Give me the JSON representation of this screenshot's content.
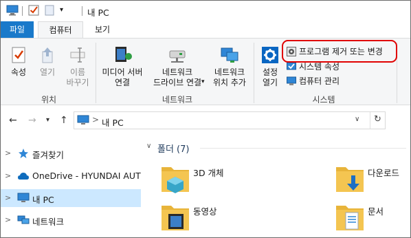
{
  "window": {
    "title": "내 PC"
  },
  "ribbon_tabs": [
    "파일",
    "컴퓨터",
    "보기"
  ],
  "ribbon": {
    "location_group": {
      "label": "위치",
      "properties": "속성",
      "open": "열기",
      "rename": "이름\n바꾸기"
    },
    "network_group": {
      "label": "네트워크",
      "media_server": "미디어 서버\n연결",
      "map_drive": "네트워크\n드라이브 연결",
      "add_location": "네트워크\n위치 추가"
    },
    "system_group": {
      "label": "시스템",
      "open_settings": "설정\n열기",
      "uninstall": "프로그램 제거 또는 변경",
      "system_properties": "시스템 속성",
      "computer_management": "컴퓨터 관리"
    }
  },
  "address_bar": {
    "path": "내 PC",
    "separator": ">"
  },
  "nav_pane": {
    "items": [
      {
        "label": "즐겨찾기",
        "icon": "star-icon",
        "selected": false
      },
      {
        "label": "OneDrive - HYUNDAI AUTOE",
        "icon": "cloud-icon",
        "selected": false
      },
      {
        "label": "내 PC",
        "icon": "computer-icon",
        "selected": true
      },
      {
        "label": "네트워크",
        "icon": "network-icon",
        "selected": false
      }
    ]
  },
  "content": {
    "section_title": "폴더 (7)",
    "folders": [
      {
        "name": "3D 개체",
        "icon": "3d-objects-folder-icon"
      },
      {
        "name": "다운로드",
        "icon": "downloads-folder-icon"
      },
      {
        "name": "동영상",
        "icon": "videos-folder-icon"
      },
      {
        "name": "문서",
        "icon": "documents-folder-icon"
      }
    ]
  },
  "colors": {
    "accent": "#1979ca",
    "selection": "#cce8ff",
    "highlight_outline": "#e00000",
    "folder": "#f4c551"
  }
}
